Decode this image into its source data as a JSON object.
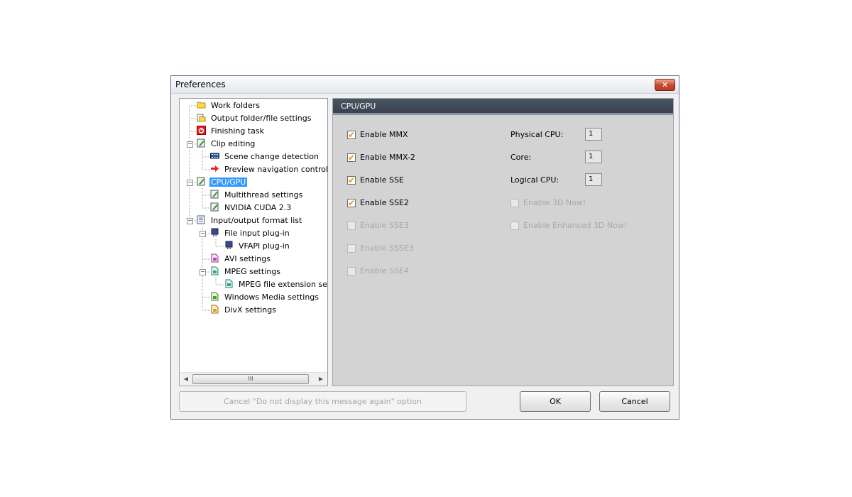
{
  "window": {
    "title": "Preferences",
    "close_glyph": "✕"
  },
  "tree": {
    "items": [
      {
        "label": "Work folders",
        "icon": "folder-icon"
      },
      {
        "label": "Output folder/file settings",
        "icon": "output-folder-icon"
      },
      {
        "label": "Finishing task",
        "icon": "power-icon"
      },
      {
        "label": "Clip editing",
        "icon": "clip-edit-icon"
      },
      {
        "label": "Scene change detection",
        "icon": "film-strip-icon"
      },
      {
        "label": "Preview navigation control",
        "icon": "red-arrow-icon"
      },
      {
        "label": "CPU/GPU",
        "icon": "cpu-icon"
      },
      {
        "label": "Multithread settings",
        "icon": "settings-page-icon"
      },
      {
        "label": "NVIDIA CUDA 2.3",
        "icon": "settings-page-icon"
      },
      {
        "label": "Input/output format list",
        "icon": "list-icon"
      },
      {
        "label": "File input plug-in",
        "icon": "plugin-icon"
      },
      {
        "label": "VFAPI plug-in",
        "icon": "plugin-icon"
      },
      {
        "label": "AVI settings",
        "icon": "avi-file-icon"
      },
      {
        "label": "MPEG settings",
        "icon": "mpeg-file-icon"
      },
      {
        "label": "MPEG file extension settings",
        "icon": "mpeg-file-icon"
      },
      {
        "label": "Windows Media settings",
        "icon": "wmv-file-icon"
      },
      {
        "label": "DivX settings",
        "icon": "divx-file-icon"
      }
    ],
    "scroll_left": "◀",
    "scroll_right": "▶",
    "scroll_grip": "III"
  },
  "panel": {
    "title": "CPU/GPU",
    "options_left": [
      {
        "label": "Enable MMX",
        "checked": true,
        "enabled": true
      },
      {
        "label": "Enable MMX-2",
        "checked": true,
        "enabled": true
      },
      {
        "label": "Enable SSE",
        "checked": true,
        "enabled": true
      },
      {
        "label": "Enable SSE2",
        "checked": true,
        "enabled": true
      },
      {
        "label": "Enable SSE3",
        "checked": false,
        "enabled": false
      },
      {
        "label": "Enable SSSE3",
        "checked": false,
        "enabled": false
      },
      {
        "label": "Enable SSE4",
        "checked": false,
        "enabled": false
      }
    ],
    "info": [
      {
        "label": "Physical CPU:",
        "value": "1"
      },
      {
        "label": "Core:",
        "value": "1"
      },
      {
        "label": "Logical CPU:",
        "value": "1"
      }
    ],
    "options_right": [
      {
        "label": "Enable 3D Now!",
        "checked": false,
        "enabled": false
      },
      {
        "label": "Enable Enhanced 3D Now!",
        "checked": false,
        "enabled": false
      }
    ]
  },
  "footer": {
    "cancel_option_label": "Cancel \"Do not display this message again\" option",
    "ok_label": "OK",
    "cancel_label": "Cancel"
  }
}
